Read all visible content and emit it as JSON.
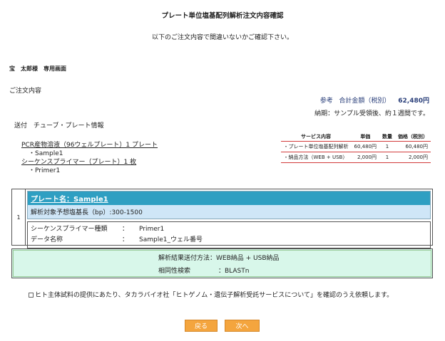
{
  "page_title": "プレート単位塩基配列解析注文内容確認",
  "confirm_message": "以下のご注文内容で間違いないかご確認下さい。",
  "user_label": "宝　太郎様　専用画面",
  "order_heading": "ご注文内容",
  "price": {
    "reference_label": "参考",
    "total_label": "合計金額（税別）",
    "total_amount": "62,480円",
    "delivery": "納期：サンプル受領後、約１週間です。"
  },
  "send_heading": "送付　チューブ・プレート情報",
  "items": [
    {
      "title": "PCR産物溶液（96ウェルプレート）1 プレート",
      "sub": "・Sample1"
    },
    {
      "title": "シーケンスプライマー（プレート）1 枚",
      "sub": "・Primer1"
    }
  ],
  "services": {
    "headers": [
      "サービス内容",
      "単価",
      "数量",
      "価格（税別）"
    ],
    "rows": [
      [
        "・プレート単位塩基配列解析",
        "60,480円",
        "1",
        "60,480円"
      ],
      [
        "・納品方法（WEB + USB）",
        "2,000円",
        "1",
        "2,000円"
      ]
    ],
    "line_color": "#d23a3a"
  },
  "sample": {
    "index": "1",
    "plate_name": "プレート名：Sample1",
    "length": "解析対象予想塩基長（bp）:300-1500",
    "details": [
      {
        "key": "シーケンスプライマー種類",
        "sep": "：",
        "value": "Primer1"
      },
      {
        "key": "データ名称",
        "sep": "：",
        "value": "Sample1_ウェル番号"
      }
    ]
  },
  "result": {
    "method_label": "解析結果送付方法：",
    "method_value": "WEB納品 + USB納品",
    "homology_label": "相同性検索",
    "homology_value": "：BLASTn"
  },
  "consent_text": "ヒト主体試料の提供にあたり、タカラバイオ社「ヒトゲノム・遺伝子解析受託サービスについて」を確認のうえ依頼します。",
  "buttons": {
    "back": "戻る",
    "next": "次へ"
  },
  "colors": {
    "accent": "#2a3f7a",
    "plate_header": "#2f9fc2",
    "result_bg": "#d8f7ea",
    "button": "#f4a53e"
  }
}
